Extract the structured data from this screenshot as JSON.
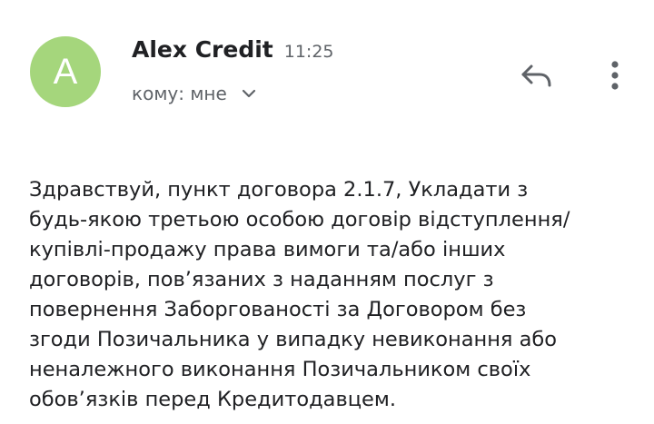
{
  "avatar": {
    "letter": "A",
    "color": "#a5d67c"
  },
  "header": {
    "sender_name": "Alex Credit",
    "time": "11:25",
    "recipient_label": "кому: мне",
    "recipient_toggle_icon": "chevron-down-icon"
  },
  "actions": {
    "reply_icon": "reply-icon",
    "more_icon": "more-vert-icon"
  },
  "message": {
    "lines": [
      "Здравствуй, пункт договора 2.1.7, Укладати з",
      "будь-якою третьою особою договір відступлення/",
      "купівлі-продажу права вимоги та/або інших",
      "договорів, пов’язаних з наданням послуг з",
      "повернення Заборгованості за Договором без",
      "згоди Позичальника у випадку невиконання або",
      "неналежного виконання Позичальником своїх",
      "обов’язків перед Кредитодавцем."
    ]
  },
  "colors": {
    "primary_text": "#202124",
    "secondary_text": "#5f6368"
  }
}
